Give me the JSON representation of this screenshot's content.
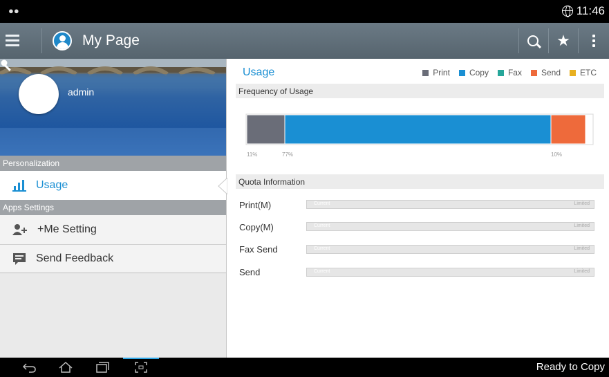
{
  "status_bar": {
    "time": "11:46"
  },
  "app_bar": {
    "title": "My Page"
  },
  "profile": {
    "username": "admin"
  },
  "sidebar": {
    "section_personalization": "Personalization",
    "usage_label": "Usage",
    "section_apps": "Apps Settings",
    "me_setting_label": "+Me Setting",
    "feedback_label": "Send Feedback"
  },
  "usage": {
    "title": "Usage",
    "legend": [
      {
        "label": "Print",
        "color": "#6a6d78"
      },
      {
        "label": "Copy",
        "color": "#1a8fd3"
      },
      {
        "label": "Fax",
        "color": "#26a69a"
      },
      {
        "label": "Send",
        "color": "#ee6a3b"
      },
      {
        "label": "ETC",
        "color": "#e8b020"
      }
    ],
    "frequency_heading": "Frequency of Usage",
    "quota_heading": "Quota Information"
  },
  "chart_data": {
    "type": "bar",
    "stacked": true,
    "orientation": "horizontal",
    "categories": [
      "Frequency of Usage"
    ],
    "series": [
      {
        "name": "Print",
        "values": [
          11
        ],
        "color": "#6a6d78",
        "label": "11%"
      },
      {
        "name": "Copy",
        "values": [
          77
        ],
        "color": "#1a8fd3",
        "label": "77%"
      },
      {
        "name": "Fax",
        "values": [
          0
        ],
        "color": "#26a69a",
        "label": ""
      },
      {
        "name": "Send",
        "values": [
          10
        ],
        "color": "#ee6a3b",
        "label": "10%"
      },
      {
        "name": "ETC",
        "values": [
          0
        ],
        "color": "#e8b020",
        "label": ""
      }
    ]
  },
  "quota": [
    {
      "label": "Print(M)",
      "current": "Current",
      "limited": "Limited"
    },
    {
      "label": "Copy(M)",
      "current": "Current",
      "limited": "Limited"
    },
    {
      "label": "Fax Send",
      "current": "Current",
      "limited": "Limited"
    },
    {
      "label": "Send",
      "current": "Current",
      "limited": "Limited"
    }
  ],
  "footer": {
    "status": "Ready to Copy"
  }
}
